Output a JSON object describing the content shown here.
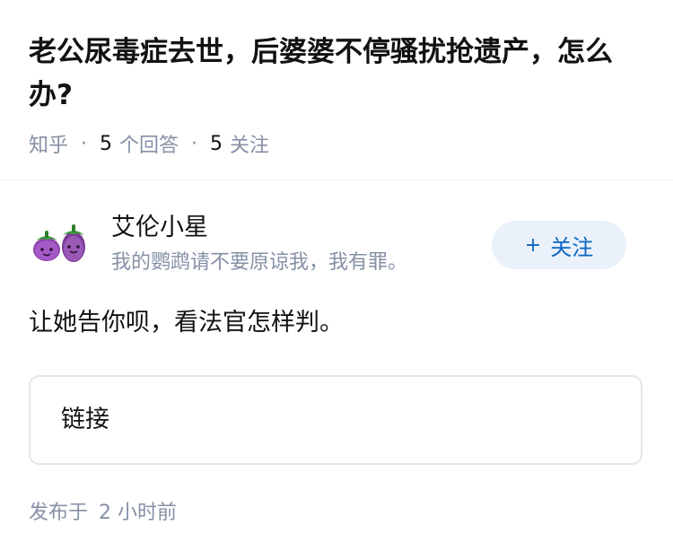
{
  "question": {
    "title": "老公尿毒症去世，后婆婆不停骚扰抢遗产，怎么办?",
    "source": "知乎",
    "answer_count": "5",
    "answer_label": "个回答",
    "follow_count": "5",
    "follow_label": "关注",
    "separator": "·"
  },
  "author": {
    "avatar_icon": "eggplant-pair-icon",
    "name": "艾伦小星",
    "bio": "我的鹦鹉请不要原谅我，我有罪。",
    "follow_button": {
      "plus": "+",
      "label": "关注"
    }
  },
  "answer": {
    "text": "让她告你呗，看法官怎样判。",
    "link_card_label": "链接"
  },
  "footer": {
    "published_prefix": "发布于",
    "published_time": "2 小时前"
  },
  "colors": {
    "title": "#121212",
    "meta": "#8590a6",
    "follow_bg": "#eaf1fb",
    "follow_text": "#0a66c2",
    "card_border": "#e4e6eb"
  }
}
